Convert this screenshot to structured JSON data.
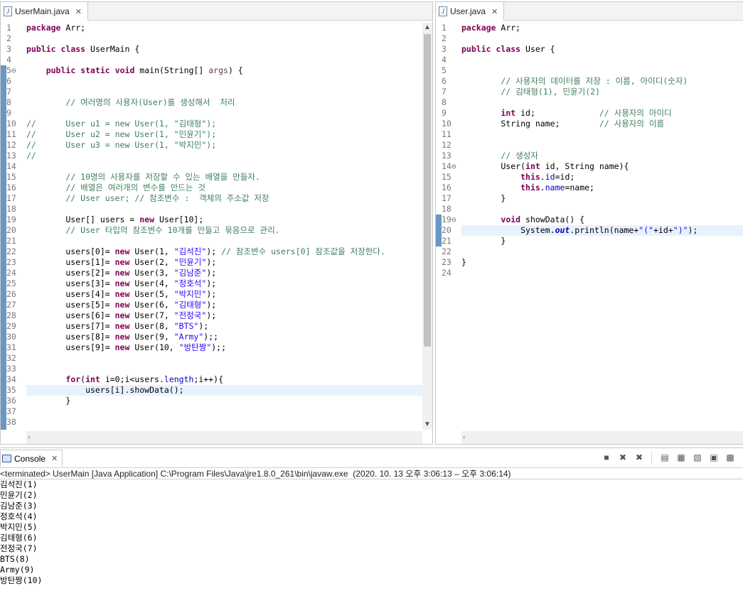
{
  "left_editor": {
    "tab_label": "UserMain.java",
    "line_numbers": [
      "1",
      "2",
      "3",
      "4",
      "5⊖",
      "6",
      "7",
      "8",
      "9",
      "10",
      "11",
      "12",
      "13",
      "14",
      "15",
      "16",
      "17",
      "18",
      "19",
      "20",
      "21",
      "22",
      "23",
      "24",
      "25",
      "26",
      "27",
      "28",
      "29",
      "30",
      "31",
      "32",
      "33",
      "34",
      "35",
      "36",
      "37",
      "38"
    ],
    "lines": [
      "package Arr;",
      "",
      "public class UserMain {",
      "",
      "    public static void main(String[] args) {",
      "",
      "",
      "        // 여러명의 사용자(User)를 생성해서  처리",
      "",
      "//      User u1 = new User(1, \"김태형\");",
      "//      User u2 = new User(1, \"민윤기\");",
      "//      User u3 = new User(1, \"박지민\");",
      "//",
      "",
      "        // 10명의 사용자를 저장할 수 있는 배열을 만들자.",
      "        // 배열은 여러개의 변수를 만드는 것",
      "        // User user; // 참조변수 :  객체의 주소값 저장",
      "",
      "        User[] users = new User[10];",
      "        // User 타입의 참조변수 10개를 만들고 묶음으로 관리.",
      "",
      "        users[0]= new User(1, \"김석진\"); // 참조변수 users[0] 참조값을 저장한다.",
      "        users[1]= new User(2, \"민윤기\");",
      "        users[2]= new User(3, \"김남준\");",
      "        users[3]= new User(4, \"정호석\");",
      "        users[4]= new User(5, \"박지민\");",
      "        users[5]= new User(6, \"김태형\");",
      "        users[6]= new User(7, \"전정국\");",
      "        users[7]= new User(8, \"BTS\");",
      "        users[8]= new User(9, \"Army\");;",
      "        users[9]= new User(10, \"방탄짱\");;",
      "",
      "",
      "        for(int i=0;i<users.length;i++){",
      "            users[i].showData();",
      "        }",
      "",
      ""
    ]
  },
  "right_editor": {
    "tab_label": "User.java",
    "line_numbers": [
      "1",
      "2",
      "3",
      "4",
      "5",
      "6",
      "7",
      "8",
      "9",
      "10",
      "11",
      "12",
      "13",
      "14⊖",
      "15",
      "16",
      "17",
      "18",
      "19⊖",
      "20",
      "21",
      "22",
      "23",
      "24"
    ],
    "lines": [
      "package Arr;",
      "",
      "public class User {",
      "",
      "",
      "        // 사용자의 데이터를 저장 : 이름, 아이디(숫자)",
      "        // 김태형(1), 민윤기(2)",
      "",
      "        int id;             // 사용자의 아이디",
      "        String name;        // 사용자의 이름",
      "",
      "",
      "        // 생성자",
      "        User(int id, String name){",
      "            this.id=id;",
      "            this.name=name;",
      "        }",
      "",
      "        void showData() {",
      "            System.out.println(name+\"(\"+id+\")\");",
      "        }",
      "",
      "}",
      ""
    ]
  },
  "console": {
    "tab_label": "Console",
    "status": "<terminated> UserMain [Java Application] C:\\Program Files\\Java\\jre1.8.0_261\\bin\\javaw.exe  (2020. 10. 13 오후 3:06:13 – 오후 3:06:14)",
    "output": [
      "김석진(1)",
      "민윤기(2)",
      "김남준(3)",
      "정호석(4)",
      "박지민(5)",
      "김태형(6)",
      "전정국(7)",
      "BTS(8)",
      "Army(9)",
      "방탄짱(10)"
    ]
  },
  "icons": {
    "java_file": "java-file-icon",
    "close": "close-icon",
    "console": "console-icon",
    "terminate": "terminate-icon",
    "remove": "remove-launch-icon",
    "remove_all": "remove-all-icon",
    "scroll_lock": "scroll-lock-icon",
    "pin": "pin-console-icon"
  },
  "colors": {
    "keyword": "#7f0055",
    "comment": "#3f7f5f",
    "string": "#2a00ff",
    "field": "#0000c0",
    "current_line": "#e8f2fe"
  }
}
